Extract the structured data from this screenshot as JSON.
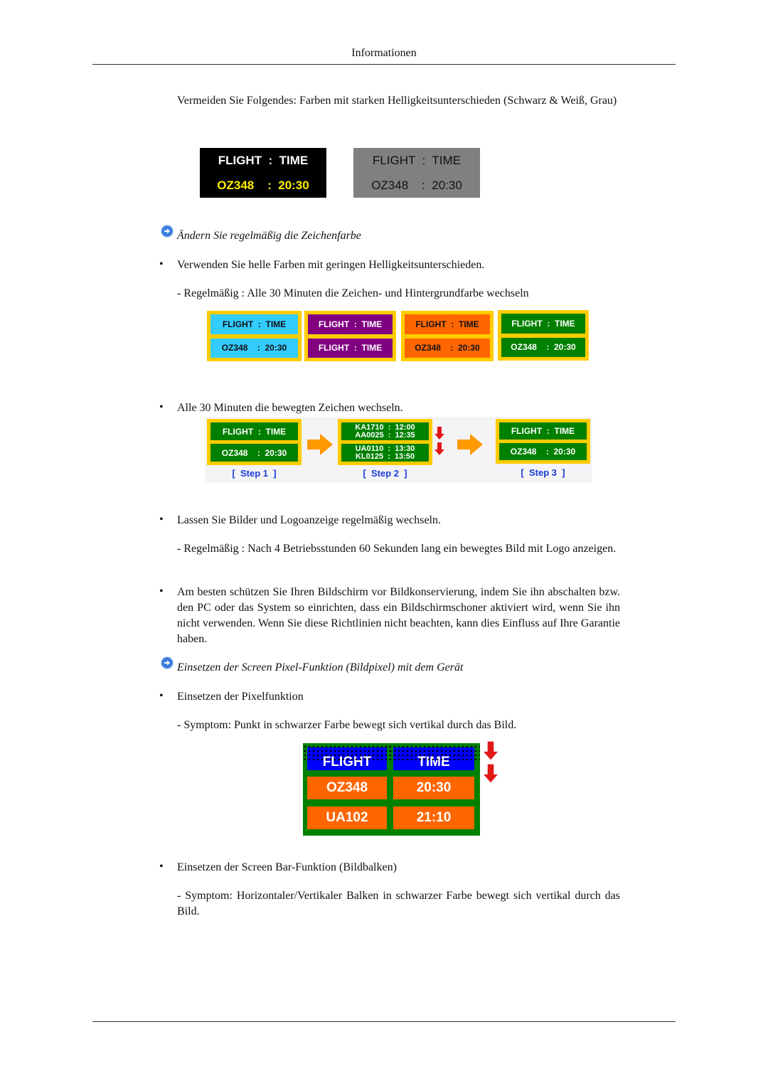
{
  "header": {
    "title": "Informationen"
  },
  "section1": {
    "text": "Vermeiden Sie Folgendes: Farben mit starken Helligkeitsunterschieden (Schwarz & Weiß, Grau)",
    "boards": [
      {
        "line1": "FLIGHT  :  TIME",
        "line2": "OZ348    :  20:30",
        "bg": "#000000",
        "line1_color": "#ffffff",
        "line2_color": "#ffee00"
      },
      {
        "line1": "FLIGHT  :  TIME",
        "line2": "OZ348    :  20:30",
        "bg": "#808080",
        "line1_color": "#111111",
        "line2_color": "#111111"
      }
    ]
  },
  "section2": {
    "heading": "Ändern Sie regelmäßig die Zeichenfarbe",
    "bullet1": "Verwenden Sie helle Farben mit geringen Helligkeitsunterschieden.",
    "sub1": "- Regelmäßig : Alle 30 Minuten die Zeichen- und Hintergrundfarbe wechseln",
    "color_panels": [
      {
        "top": "FLIGHT  :  TIME",
        "bottom": "OZ348    :  20:30",
        "bg": "#33ccff",
        "fg": "#111111"
      },
      {
        "top": "FLIGHT  :  TIME",
        "bottom": "FLIGHT  :  TIME",
        "bg": "#800080",
        "fg": "#ffffff"
      },
      {
        "top": "FLIGHT  :  TIME",
        "bottom": "OZ348    :  20:30",
        "bg": "#ff6600",
        "fg": "#111111"
      },
      {
        "top": "FLIGHT  :  TIME",
        "bottom": "OZ348    :  20:30",
        "bg": "#008000",
        "fg": "#ffffff"
      }
    ],
    "bullet2": "Alle 30 Minuten die bewegten Zeichen wechseln.",
    "steps": [
      {
        "top": "FLIGHT  :  TIME",
        "bottom": "OZ348    :  20:30",
        "label": "[  Step 1  ]"
      },
      {
        "top_a": "KA1710  :  12:00",
        "top_b": "AA0025  :  12:35",
        "bottom_a": "UA0110  :  13:30",
        "bottom_b": "KL0125  :  13:50",
        "label": "[  Step 2  ]"
      },
      {
        "top": "FLIGHT  :  TIME",
        "bottom": "OZ348    :  20:30",
        "label": "[  Step 3  ]"
      }
    ],
    "bullet3": "Lassen Sie Bilder und Logoanzeige regelmäßig wechseln.",
    "sub3": "- Regelmäßig : Nach 4 Betriebsstunden 60 Sekunden lang ein bewegtes Bild mit Logo anzeigen.",
    "bullet4": "Am besten schützen Sie Ihren Bildschirm vor Bildkonservierung, indem Sie ihn abschalten bzw. den PC oder das System so einrichten, dass ein Bildschirmschoner aktiviert wird, wenn Sie ihn nicht verwenden. Wenn Sie diese Richtlinien nicht beachten, kann dies Einfluss auf Ihre Garantie haben."
  },
  "section3": {
    "heading": "Einsetzen der Screen Pixel-Funktion (Bildpixel) mit dem Gerät",
    "bullet1": "Einsetzen der Pixelfunktion",
    "sub1": "- Symptom: Punkt in schwarzer Farbe bewegt sich vertikal durch das Bild.",
    "pixel_board": {
      "header": [
        "FLIGHT",
        "TIME"
      ],
      "rows": [
        [
          "OZ348",
          "20:30"
        ],
        [
          "UA102",
          "21:10"
        ]
      ],
      "colors": {
        "frame": "#008000",
        "header_bg": "#0000ff",
        "row_bg": "#ff6600",
        "text": "#ffffff"
      }
    },
    "bullet2": "Einsetzen der Screen Bar-Funktion (Bildbalken)",
    "sub2": "- Symptom: Horizontaler/Vertikaler Balken in schwarzer Farbe bewegt sich vertikal durch das Bild."
  }
}
